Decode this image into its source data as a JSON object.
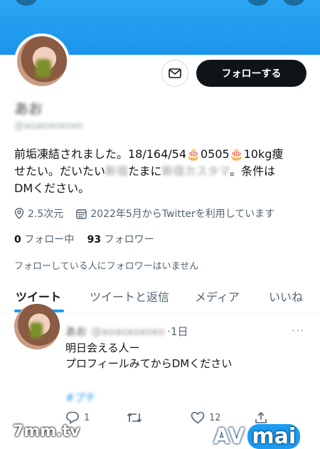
{
  "profile": {
    "name": "あお",
    "handle": "@aoaoxoxoxo",
    "follow_label": "フォローする",
    "bio_line1": "前垢凍結されました。18/164/54🎂0505🎂10kg痩",
    "bio_line2_a": "せたい。だいたい",
    "bio_line2_blur1": "新宿",
    "bio_line2_b": "たまに",
    "bio_line2_blur2": "新宿カスタマ",
    "bio_line2_c": "。条件は",
    "bio_line3": "DMください。",
    "location": "2.5次元",
    "joined": "2022年5月からTwitterを利用しています",
    "following_count": "0",
    "following_label": "フォロー中",
    "followers_count": "93",
    "followers_label": "フォロワー",
    "no_known_followers": "フォローしている人にフォロワーはいません"
  },
  "tabs": [
    "ツイート",
    "ツイートと返信",
    "メディア",
    "いいね"
  ],
  "tweet": {
    "name": "あお",
    "handle": "@aoaoxoxoxo",
    "time": "1日",
    "more": "···",
    "line1": "明日会える人ー",
    "line2": "プロフィールみてからDMください",
    "hashtag": "#プチ",
    "reply_count": "1",
    "like_count": "12"
  },
  "watermarks": {
    "left": "7mm.tv",
    "right_a": "AV",
    "right_b": "mai"
  },
  "colors": {
    "accent": "#1d9bf0",
    "text": "#0f1419",
    "secondary": "#536471"
  },
  "icons": [
    "mail-icon",
    "location-icon",
    "calendar-icon",
    "reply-icon",
    "retweet-icon",
    "like-icon",
    "share-icon"
  ]
}
